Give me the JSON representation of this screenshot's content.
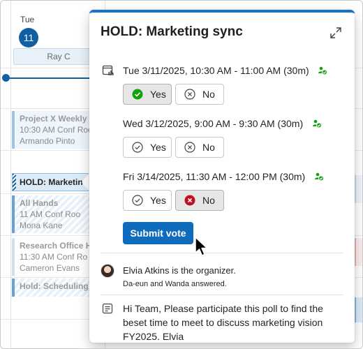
{
  "calendar": {
    "day_label": "Tue",
    "date_number": "11",
    "allday_event": "Ray C",
    "events": [
      {
        "title": "Project X Weekly s",
        "location": "10:30 AM  Conf Roo",
        "person": "Armando Pinto"
      },
      {
        "title": "HOLD: Marketin",
        "selected": true
      },
      {
        "title": "All Hands",
        "location": "11 AM  Conf Roo",
        "person": "Mona Kane"
      },
      {
        "title": "Research Office Ho",
        "location": "11:30 AM  Conf Ro",
        "person": "Cameron Evans"
      },
      {
        "title": "Hold: Scheduling F"
      }
    ]
  },
  "popup": {
    "title": "HOLD: Marketing sync",
    "slots": [
      {
        "text": "Tue 3/11/2025, 10:30 AM - 11:00 AM (30m)",
        "vote": "yes"
      },
      {
        "text": "Wed 3/12/2025, 9:00 AM - 9:30 AM (30m)",
        "vote": "none"
      },
      {
        "text": "Fri 3/14/2025, 11:30 AM - 12:00 PM (30m)",
        "vote": "no"
      }
    ],
    "yes_label": "Yes",
    "no_label": "No",
    "submit_label": "Submit vote",
    "organizer_text": "Elvia Atkins is the organizer.",
    "answered_text": "Da-eun and Wanda answered.",
    "notes": "Hi Team, Please participate this poll to find the beset time to meet to discuss marketing vision FY2025. Elvia"
  },
  "colors": {
    "accent": "#0f6cbd",
    "success": "#13a10e",
    "danger": "#c50f1f"
  }
}
